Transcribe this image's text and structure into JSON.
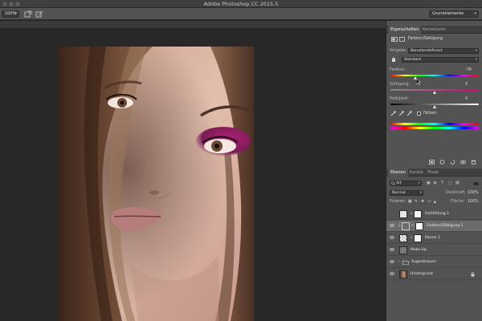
{
  "window": {
    "title": "Adobe Photoshop CC 2015.5"
  },
  "options_bar": {
    "zoom": "100%",
    "workspace": "Grundelemente"
  },
  "properties_panel": {
    "tabs": [
      "Eigenschaften",
      "Korrekturen"
    ],
    "header": "Farbton/Sättigung",
    "preset_label": "Vorgabe:",
    "preset_value": "Benutzerdefiniert",
    "channel_value": "Standard",
    "hue_label": "Farbton:",
    "hue_value": "-78",
    "saturation_label": "Sättigung:",
    "saturation_value": "0",
    "lightness_label": "Helligkeit:",
    "lightness_value": "0",
    "colorize_label": "Färben",
    "slider_levels": {
      "hue": -78,
      "saturation": 0,
      "lightness": 0
    }
  },
  "layers_panel": {
    "tabs": [
      "Ebenen",
      "Kanäle",
      "Pfade"
    ],
    "filter_value": "Art",
    "blend_mode": "Normal",
    "opacity_label": "Deckkraft:",
    "opacity_value": "100%",
    "lock_label": "Fixieren:",
    "fill_label": "Fläche:",
    "fill_value": "100%",
    "layers": [
      {
        "name": "Farbfüllung 1",
        "visible": false,
        "selected": false
      },
      {
        "name": "Farbton/Sättigung 1",
        "visible": true,
        "selected": true
      },
      {
        "name": "Ebene 1",
        "visible": true,
        "selected": false
      },
      {
        "name": "Make-Up",
        "visible": true,
        "selected": false
      },
      {
        "name": "Augenbrauen",
        "visible": true,
        "selected": false
      },
      {
        "name": "Hintergrund",
        "visible": true,
        "selected": false
      }
    ]
  },
  "colors": {
    "panel_bg": "#535353",
    "selected_layer": "#6b6b6b",
    "eyeshadow": "#8b1e5a"
  }
}
